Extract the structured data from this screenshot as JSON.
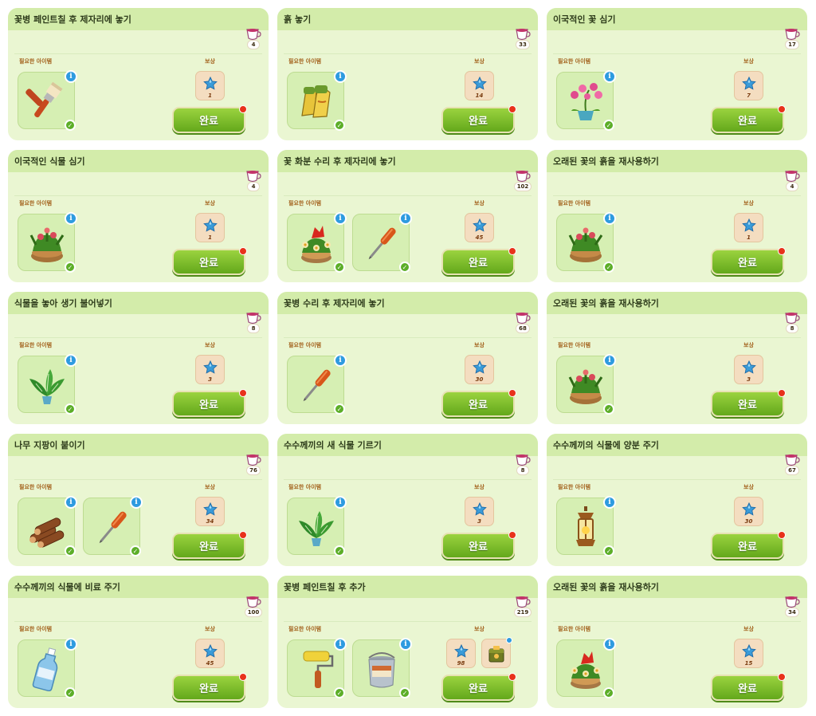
{
  "labels": {
    "required": "필요한 아이템",
    "reward": "보상",
    "complete": "완료"
  },
  "colors": {
    "card_bg": "#eaf6d2",
    "header_bg": "#d3ecaa",
    "button_green": "#63a81b",
    "notify_red": "#e8321b",
    "info_blue": "#2e9be0"
  },
  "tasks": [
    {
      "title": "꽃병 페인트칠 후 제자리에 놓기",
      "cost": "4",
      "items": [
        {
          "icon": "paintbrush-icon"
        }
      ],
      "rewards": [
        {
          "icon": "blue-star-gem-icon",
          "value": "1"
        }
      ]
    },
    {
      "title": "흙 놓기",
      "cost": "33",
      "items": [
        {
          "icon": "gardening-gloves-icon"
        }
      ],
      "rewards": [
        {
          "icon": "blue-star-gem-icon",
          "value": "14"
        }
      ]
    },
    {
      "title": "이국적인 꽃 심기",
      "cost": "17",
      "items": [
        {
          "icon": "orchid-pot-icon"
        }
      ],
      "rewards": [
        {
          "icon": "blue-star-gem-icon",
          "value": "7"
        }
      ]
    },
    {
      "title": "이국적인 식물 심기",
      "cost": "4",
      "items": [
        {
          "icon": "flower-basket-icon"
        }
      ],
      "rewards": [
        {
          "icon": "blue-star-gem-icon",
          "value": "1"
        }
      ]
    },
    {
      "title": "꽃 화분 수리 후 제자리에 놓기",
      "cost": "102",
      "items": [
        {
          "icon": "red-flower-basket-icon"
        },
        {
          "icon": "screwdriver-icon"
        }
      ],
      "rewards": [
        {
          "icon": "blue-star-gem-icon",
          "value": "45"
        }
      ]
    },
    {
      "title": "오래된 꽃의 흙을 재사용하기",
      "cost": "4",
      "items": [
        {
          "icon": "flower-basket-icon"
        }
      ],
      "rewards": [
        {
          "icon": "blue-star-gem-icon",
          "value": "1"
        }
      ]
    },
    {
      "title": "식물을 놓아 생기 불어넣기",
      "cost": "8",
      "items": [
        {
          "icon": "leafy-plant-pot-icon"
        }
      ],
      "rewards": [
        {
          "icon": "blue-star-gem-icon",
          "value": "3"
        }
      ]
    },
    {
      "title": "꽃병 수리 후 제자리에 놓기",
      "cost": "68",
      "items": [
        {
          "icon": "screwdriver-icon"
        }
      ],
      "rewards": [
        {
          "icon": "blue-star-gem-icon",
          "value": "30"
        }
      ]
    },
    {
      "title": "오래된 꽃의 흙을 재사용하기",
      "cost": "8",
      "items": [
        {
          "icon": "flower-basket-icon"
        }
      ],
      "rewards": [
        {
          "icon": "blue-star-gem-icon",
          "value": "3"
        }
      ]
    },
    {
      "title": "나무 지팡이 붙이기",
      "cost": "76",
      "items": [
        {
          "icon": "firewood-logs-icon"
        },
        {
          "icon": "screwdriver-icon"
        }
      ],
      "rewards": [
        {
          "icon": "blue-star-gem-icon",
          "value": "34"
        }
      ]
    },
    {
      "title": "수수께끼의 새 식물 기르기",
      "cost": "8",
      "items": [
        {
          "icon": "leafy-plant-pot-icon"
        }
      ],
      "rewards": [
        {
          "icon": "blue-star-gem-icon",
          "value": "3"
        }
      ]
    },
    {
      "title": "수수께끼의 식물에 양분 주기",
      "cost": "67",
      "items": [
        {
          "icon": "lantern-icon"
        }
      ],
      "rewards": [
        {
          "icon": "blue-star-gem-icon",
          "value": "30"
        }
      ]
    },
    {
      "title": "수수께끼의 식물에 비료 주기",
      "cost": "100",
      "items": [
        {
          "icon": "fertilizer-bottle-icon"
        }
      ],
      "rewards": [
        {
          "icon": "blue-star-gem-icon",
          "value": "45"
        }
      ]
    },
    {
      "title": "꽃병 페인트칠 후 추가",
      "cost": "219",
      "items": [
        {
          "icon": "paint-roller-icon"
        },
        {
          "icon": "paint-bucket-icon"
        }
      ],
      "rewards": [
        {
          "icon": "blue-star-gem-icon",
          "value": "98"
        },
        {
          "icon": "decor-box-icon",
          "value": ""
        }
      ]
    },
    {
      "title": "오래된 꽃의 흙을 재사용하기",
      "cost": "34",
      "items": [
        {
          "icon": "red-flower-basket-icon"
        }
      ],
      "rewards": [
        {
          "icon": "blue-star-gem-icon",
          "value": "15"
        }
      ]
    }
  ]
}
